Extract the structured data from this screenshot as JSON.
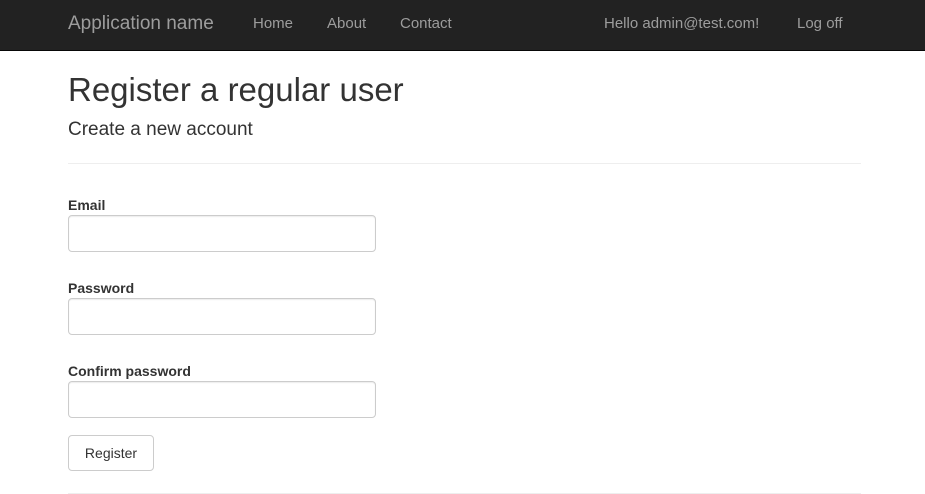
{
  "navbar": {
    "brand": "Application name",
    "links": [
      {
        "label": "Home"
      },
      {
        "label": "About"
      },
      {
        "label": "Contact"
      }
    ],
    "greeting": "Hello admin@test.com!",
    "logoff": "Log off"
  },
  "page": {
    "title": "Register a regular user",
    "subtitle": "Create a new account"
  },
  "form": {
    "email": {
      "label": "Email",
      "value": "",
      "placeholder": ""
    },
    "password": {
      "label": "Password",
      "value": "",
      "placeholder": ""
    },
    "confirm_password": {
      "label": "Confirm password",
      "value": "",
      "placeholder": ""
    },
    "submit_label": "Register"
  },
  "colors": {
    "navbar_bg": "#222222",
    "navbar_text": "#9d9d9d",
    "text": "#333333",
    "input_border": "#cccccc"
  }
}
